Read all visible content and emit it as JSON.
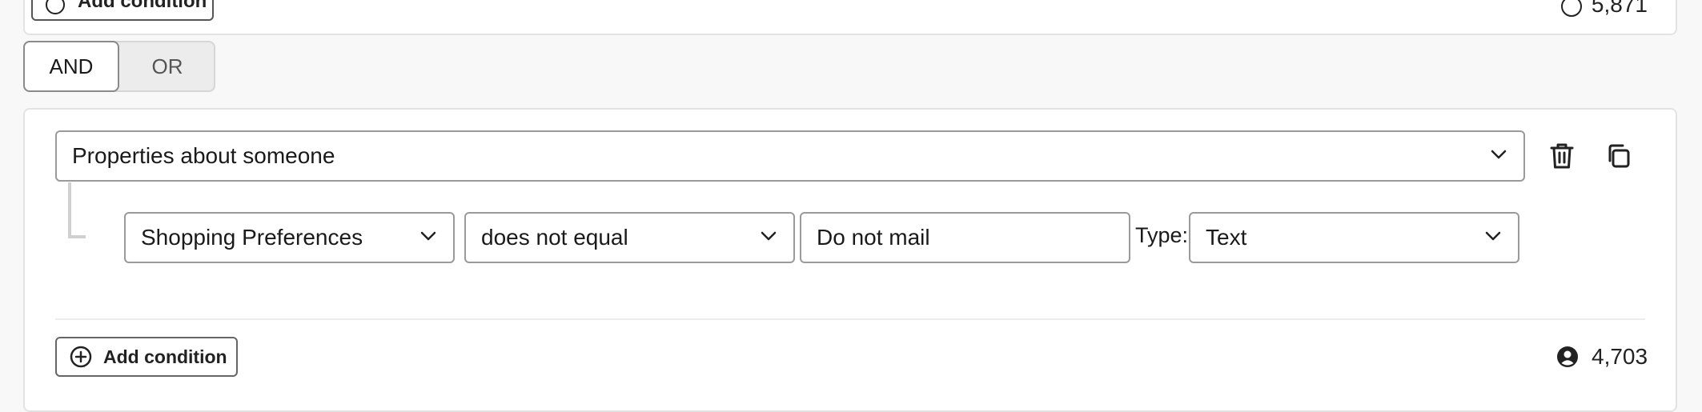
{
  "previous_group": {
    "add_condition_label": "Add condition",
    "count": "5,871"
  },
  "logic_toggle": {
    "and_label": "AND",
    "or_label": "OR",
    "selected": "AND"
  },
  "condition_group": {
    "category_select": "Properties about someone",
    "property_select": "Shopping Preferences",
    "operator_select": "does not equal",
    "value_input": "Do not mail",
    "type_label": "Type:",
    "type_select": "Text",
    "add_condition_label": "Add condition",
    "count": "4,703"
  },
  "icons": {
    "delete": "trash-icon",
    "duplicate": "copy-icon",
    "add": "plus-circle-icon",
    "count": "person-icon",
    "dropdown": "chevron-down-icon"
  }
}
